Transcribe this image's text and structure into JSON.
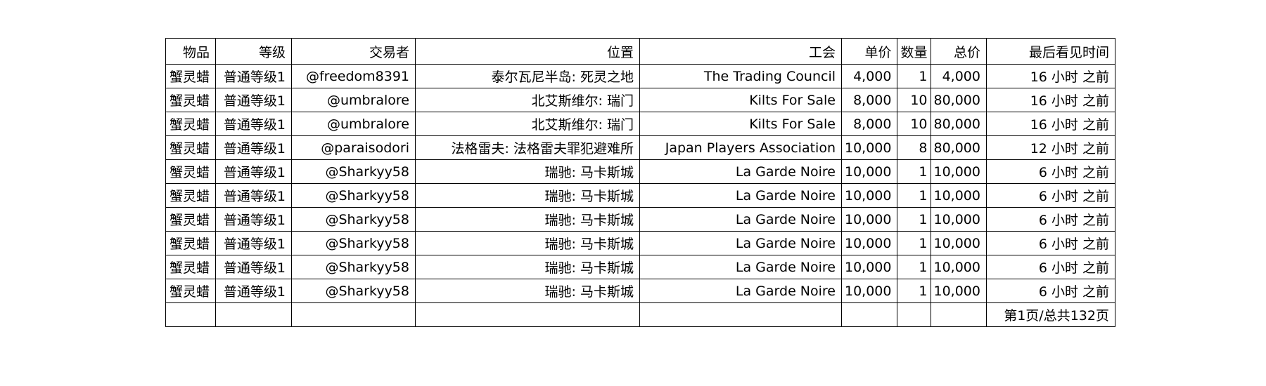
{
  "table": {
    "headers": [
      "物品",
      "等级",
      "交易者",
      "位置",
      "工会",
      "单价",
      "数量",
      "总价",
      "最后看见时间"
    ],
    "rows": [
      [
        "蟹灵蜡",
        "普通等级1",
        "@freedom8391",
        "泰尔瓦尼半岛: 死灵之地",
        "The Trading Council",
        "4,000",
        "1",
        "4,000",
        "16 小时 之前"
      ],
      [
        "蟹灵蜡",
        "普通等级1",
        "@umbralore",
        "北艾斯维尔: 瑞门",
        "Kilts For Sale",
        "8,000",
        "10",
        "80,000",
        "16 小时 之前"
      ],
      [
        "蟹灵蜡",
        "普通等级1",
        "@umbralore",
        "北艾斯维尔: 瑞门",
        "Kilts For Sale",
        "8,000",
        "10",
        "80,000",
        "16 小时 之前"
      ],
      [
        "蟹灵蜡",
        "普通等级1",
        "@paraisodori",
        "法格雷夫: 法格雷夫罪犯避难所",
        "Japan Players Association",
        "10,000",
        "8",
        "80,000",
        "12 小时 之前"
      ],
      [
        "蟹灵蜡",
        "普通等级1",
        "@Sharkyy58",
        "瑞驰: 马卡斯城",
        "La Garde Noire",
        "10,000",
        "1",
        "10,000",
        "6 小时 之前"
      ],
      [
        "蟹灵蜡",
        "普通等级1",
        "@Sharkyy58",
        "瑞驰: 马卡斯城",
        "La Garde Noire",
        "10,000",
        "1",
        "10,000",
        "6 小时 之前"
      ],
      [
        "蟹灵蜡",
        "普通等级1",
        "@Sharkyy58",
        "瑞驰: 马卡斯城",
        "La Garde Noire",
        "10,000",
        "1",
        "10,000",
        "6 小时 之前"
      ],
      [
        "蟹灵蜡",
        "普通等级1",
        "@Sharkyy58",
        "瑞驰: 马卡斯城",
        "La Garde Noire",
        "10,000",
        "1",
        "10,000",
        "6 小时 之前"
      ],
      [
        "蟹灵蜡",
        "普通等级1",
        "@Sharkyy58",
        "瑞驰: 马卡斯城",
        "La Garde Noire",
        "10,000",
        "1",
        "10,000",
        "6 小时 之前"
      ],
      [
        "蟹灵蜡",
        "普通等级1",
        "@Sharkyy58",
        "瑞驰: 马卡斯城",
        "La Garde Noire",
        "10,000",
        "1",
        "10,000",
        "6 小时 之前"
      ]
    ],
    "pagination": "第1页/总共132页"
  }
}
